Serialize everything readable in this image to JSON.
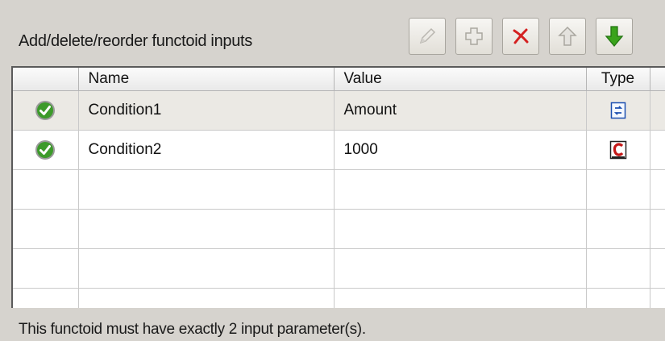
{
  "header": {
    "label": "Add/delete/reorder functoid inputs"
  },
  "toolbar": {
    "buttons": [
      {
        "name": "edit-button",
        "icon": "pencil-icon",
        "enabled": false
      },
      {
        "name": "add-button",
        "icon": "plus-icon",
        "enabled": false
      },
      {
        "name": "delete-button",
        "icon": "delete-x-icon",
        "enabled": true
      },
      {
        "name": "move-up-button",
        "icon": "arrow-up-icon",
        "enabled": false
      },
      {
        "name": "move-down-button",
        "icon": "arrow-down-icon",
        "enabled": true
      }
    ]
  },
  "grid": {
    "columns": {
      "name": "Name",
      "value": "Value",
      "type": "Type"
    },
    "rows": [
      {
        "status_icon": "check-icon",
        "name": "Condition1",
        "value": "Amount",
        "type_icon": "link-parameter-icon",
        "selected": true
      },
      {
        "status_icon": "check-icon",
        "name": "Condition2",
        "value": "1000",
        "type_icon": "constant-parameter-icon",
        "selected": false
      }
    ]
  },
  "status": {
    "message": "This functoid must have exactly 2 input parameter(s)."
  },
  "colors": {
    "check_green": "#3c9a2a",
    "delete_red": "#d42020",
    "arrow_down_green": "#3aa31b",
    "window_bg": "#d6d3ce"
  }
}
